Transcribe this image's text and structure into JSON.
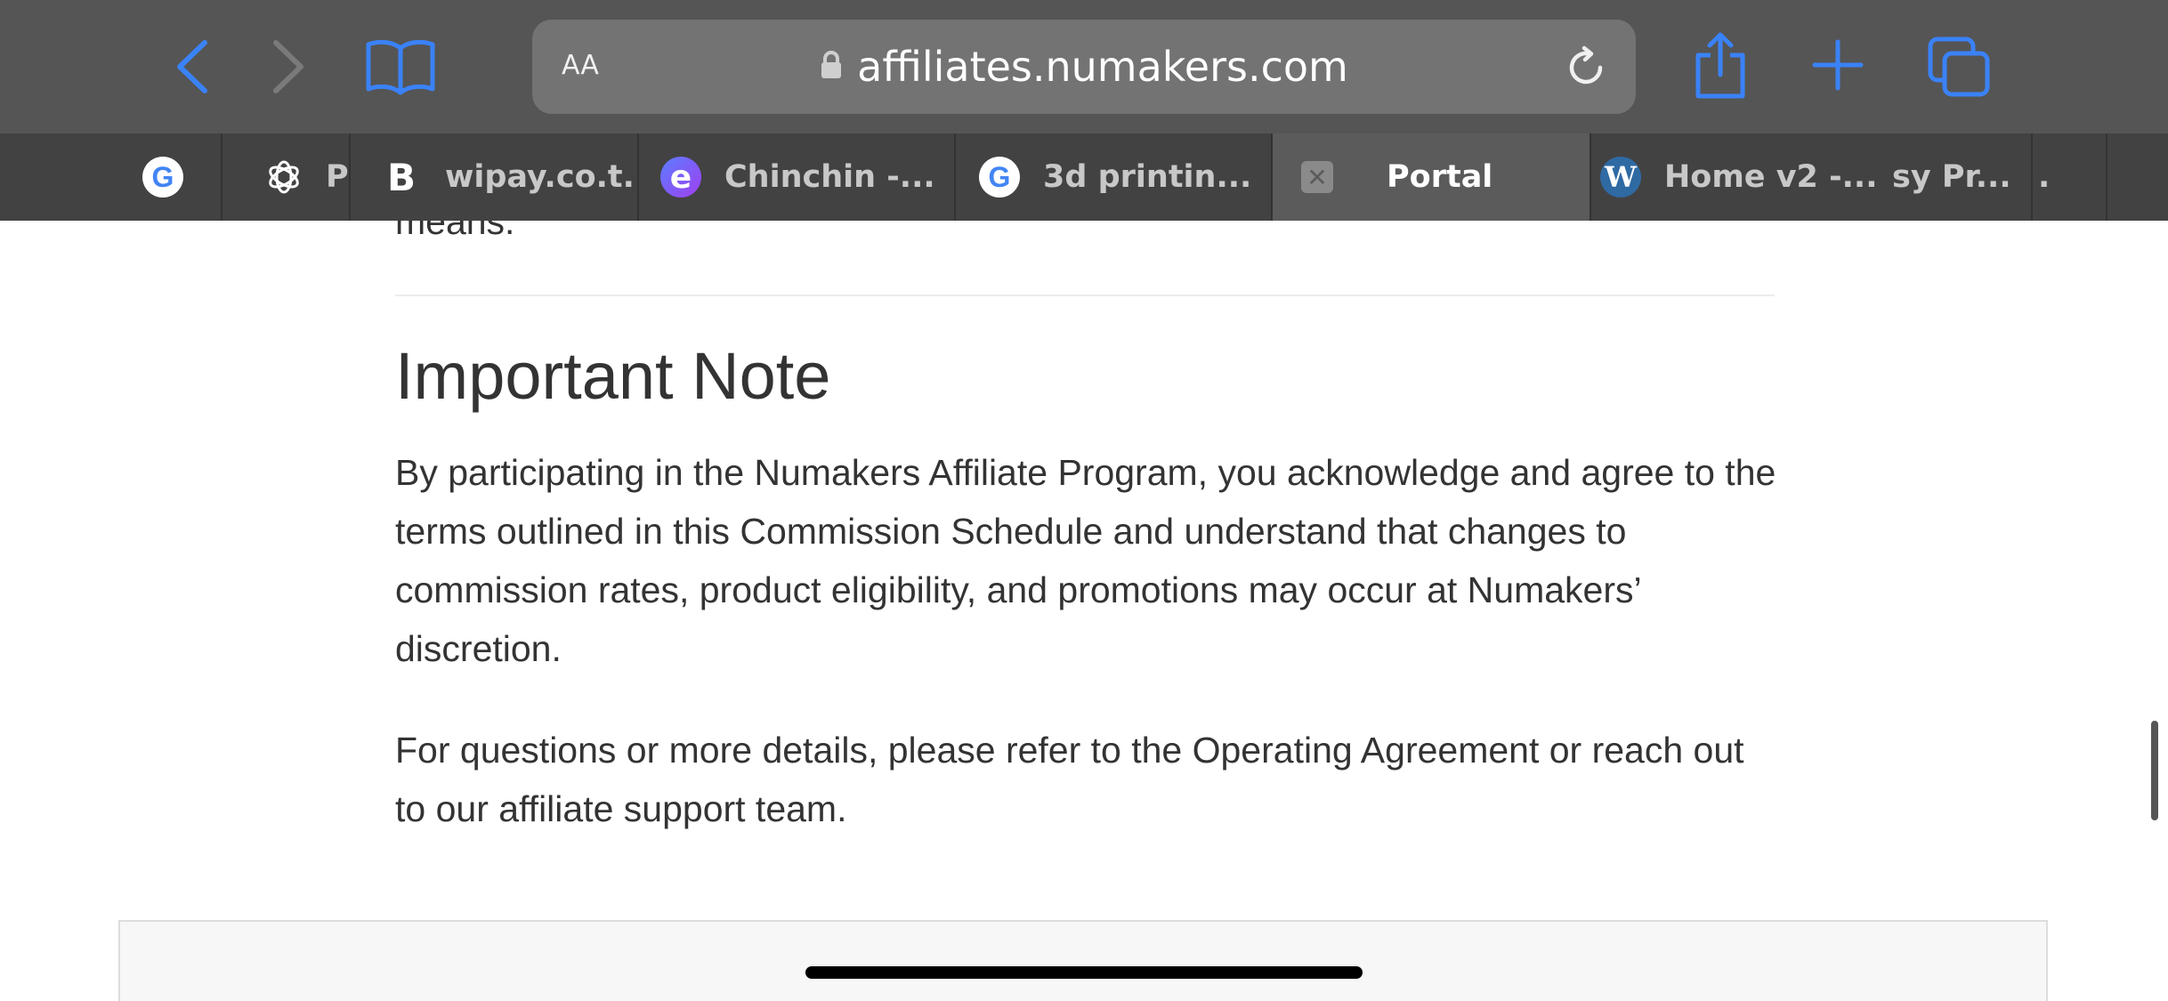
{
  "browser": {
    "url": "affiliates.numakers.com",
    "text_size_button": "AA",
    "tabs": [
      {
        "label": "",
        "favicon": "google-icon"
      },
      {
        "label": "P",
        "favicon": "openai-icon"
      },
      {
        "label": "wipay.co.t...",
        "favicon": "b-icon"
      },
      {
        "label": "Chinchin -...",
        "favicon": "e-icon"
      },
      {
        "label": "3d printin...",
        "favicon": "google-icon"
      },
      {
        "label": "Portal",
        "favicon": "close-icon",
        "active": true
      },
      {
        "label": "Home v2 -...",
        "favicon": "wordpress-icon"
      },
      {
        "label": "sy Pr...",
        "favicon": ""
      },
      {
        "label": ".",
        "favicon": ""
      },
      {
        "label": "",
        "favicon": ""
      }
    ]
  },
  "page": {
    "cut_text": "means.",
    "heading": "Important Note",
    "paragraph_1": "By participating in the Numakers Affiliate Program, you acknowledge and agree to the terms outlined in this Commission Schedule and understand that changes to commission rates, product eligibility, and promotions may occur at Numakers’ discretion.",
    "paragraph_2": "For questions or more details, please refer to the Operating Agreement or reach out to our affiliate support team."
  },
  "colors": {
    "toolbar": "#555555",
    "tabbar": "#424242",
    "accent": "#3a82f7",
    "text": "#333333"
  }
}
